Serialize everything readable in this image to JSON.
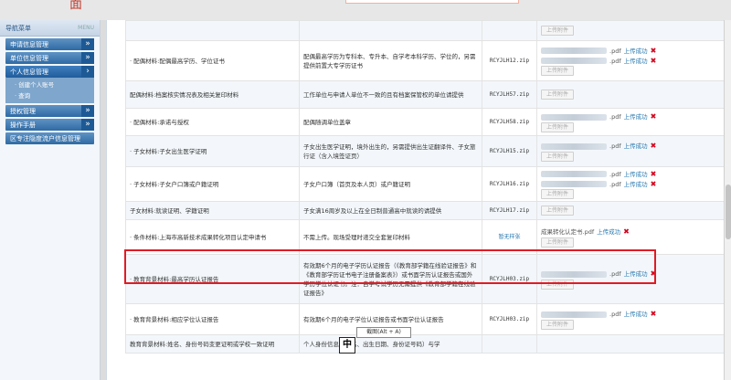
{
  "header": {
    "title_fragment": "面"
  },
  "sidebar": {
    "title": "导航菜单",
    "menu_word": "MENU",
    "items": [
      {
        "label": "申请信息管理",
        "arrow": "»"
      },
      {
        "label": "单位信息管理",
        "arrow": "»"
      },
      {
        "label": "个人信息管理",
        "arrow": "›"
      }
    ],
    "sub_items": [
      "· 创建个人账号",
      "· 查询"
    ],
    "items_after": [
      {
        "label": "授权管理",
        "arrow": "»"
      },
      {
        "label": "操作手册",
        "arrow": "»"
      },
      {
        "label": "区专注隐度流户信息管理",
        "arrow": ""
      }
    ]
  },
  "upload_btn_label": "上传附件",
  "upload_ok_label": "上传成功",
  "rows": [
    {
      "name": "",
      "desc": "",
      "code": "",
      "files": [],
      "upload": true
    },
    {
      "name": "· 配偶材料:配偶最高学历、学位证书",
      "desc": "配偶最高学历为专科本、专升本、自学考本科学历、学位的，另需提供前置大专学历证书",
      "code": "RCYJLH12.zip",
      "files": [
        ".pdf",
        ".pdf"
      ],
      "upload": true
    },
    {
      "name": "配偶材料:档案核实情况表及相关复印材料",
      "desc": "工作单位与申请人单位不一致的且有档案保管权的单位请提供",
      "code": "RCYJLH57.zip",
      "files": [],
      "upload": true
    },
    {
      "name": "· 配偶材料:承诺与授权",
      "desc": "配偶随调单位盖章",
      "code": "RCYJLH58.zip",
      "files": [
        ".pdf"
      ],
      "upload": true
    },
    {
      "name": "· 子女材料:子女出生医学证明",
      "desc": "子女出生医学证明，境外出生的，另需提供出生证翻译件、子女旅行证（含入境签证页）",
      "code": "RCYJLH15.zip",
      "files": [
        ".pdf"
      ],
      "upload": true
    },
    {
      "name": "· 子女材料:子女户口簿或户籍证明",
      "desc": "子女户口簿（首页及本人页）或户籍证明",
      "code": "RCYJLH16.zip",
      "files": [
        ".pdf",
        ".pdf"
      ],
      "upload": true
    },
    {
      "name": "子女材料:就读证明、学籍证明",
      "desc": "子女满16周岁及以上在全日制普通高中就读的请提供",
      "code": "RCYJLH17.zip",
      "files": [],
      "upload": true
    },
    {
      "name": "· 条件材料:上海市高新技术成果转化项目认定申请书",
      "desc": "不需上传。现场受理时递交全套复印材料",
      "code": "暂无样张",
      "files": [
        "成果转化认定书.pdf"
      ],
      "upload": true
    },
    {
      "name": "· 教育背景材料:最高学历认证报告",
      "desc": "有效期6个月的电子学历认证报告（《教育部学籍在线验证报告》和《教育部学历证书电子注册备案表》）或书面学历认证报告或国外学历学位认证书。注：自学考试学历无需提供《教育部学籍在线验证报告》",
      "code": "RCYJLH03.zip",
      "files": [
        ".pdf"
      ],
      "upload": true
    },
    {
      "name": "· 教育背景材料:相应学位认证报告",
      "desc": "有效期6个月的电子学位认证报告或书面学位认证报告",
      "code": "RCYJLH03.zip",
      "files": [
        ".pdf"
      ],
      "upload": true
    },
    {
      "name": "教育背景材料:姓名、身份号码变更证明或学校一致证明",
      "desc": "个人身份信息（姓名、出生日期、身份证号码）与学",
      "code": "",
      "files": [],
      "upload": false
    }
  ],
  "tooltip": "截图(Alt + A)",
  "ime": "中"
}
